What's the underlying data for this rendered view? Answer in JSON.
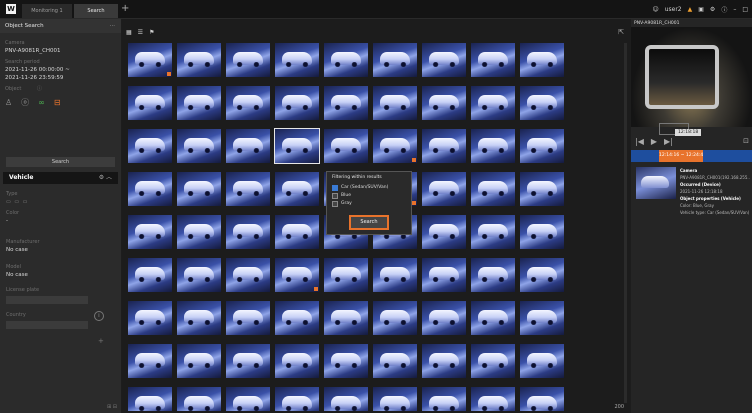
{
  "app": {
    "logo": "W"
  },
  "tabs": [
    {
      "label": "Monitoring 1"
    },
    {
      "label": "Search"
    }
  ],
  "topbar": {
    "user": "user2",
    "plus": "+"
  },
  "left": {
    "header": "Object Search",
    "camera_label": "Camera",
    "camera_value": "PNV-A9081R_CH001",
    "period_label": "Search period",
    "period_start": "2021-11-26 00:00:00 ~",
    "period_end": "2021-11-26 23:59:59",
    "object_label": "Object",
    "search_button": "Search",
    "vehicle_title": "Vehicle",
    "type_label": "Type",
    "color_label": "Color",
    "color_value": "-",
    "manufacturer_label": "Manufacturer",
    "manufacturer_value": "No case",
    "model_label": "Model",
    "model_value": "No case",
    "plate_label": "License plate",
    "country_label": "Country"
  },
  "center": {
    "count": "200"
  },
  "popup": {
    "title": "Filtering within results",
    "options": [
      {
        "label": "Car (Sedan/SUV/Van)",
        "checked": true
      },
      {
        "label": "Blue",
        "checked": false
      },
      {
        "label": "Gray",
        "checked": false
      }
    ],
    "search_button": "Search"
  },
  "right": {
    "channel": "PNV-A9081R_CH001",
    "time_tip": "12:18:18",
    "timeline_label": "12:14:16 ~ 12:24:47",
    "result_camera_label": "Camera",
    "result_camera_value": "PNV-A9081R_CH001(192.168.255...",
    "occurred_label": "Occurred (Device)",
    "occurred_value": "2021-11-26 12:18:18",
    "props_label": "Object properties (Vehicle)",
    "color_value": "Color: Blue, Gray",
    "type_value": "Vehicle type: Car (Sedan/SUV/Van)"
  }
}
